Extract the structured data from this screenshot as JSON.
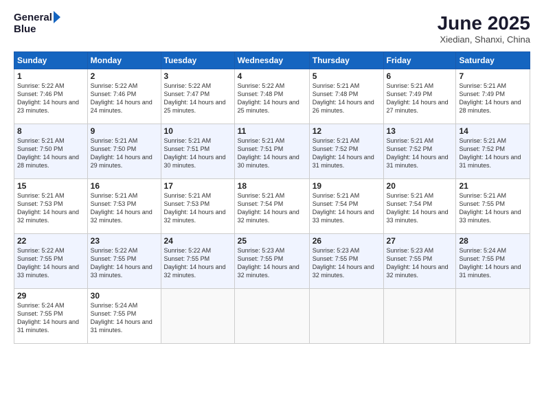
{
  "header": {
    "logo_line1": "General",
    "logo_line2": "Blue",
    "title": "June 2025",
    "subtitle": "Xiedian, Shanxi, China"
  },
  "calendar": {
    "days_of_week": [
      "Sunday",
      "Monday",
      "Tuesday",
      "Wednesday",
      "Thursday",
      "Friday",
      "Saturday"
    ],
    "weeks": [
      [
        null,
        {
          "day": 2,
          "sunrise": "5:22 AM",
          "sunset": "7:46 PM",
          "daylight": "14 hours and 24 minutes."
        },
        {
          "day": 3,
          "sunrise": "5:22 AM",
          "sunset": "7:47 PM",
          "daylight": "14 hours and 25 minutes."
        },
        {
          "day": 4,
          "sunrise": "5:22 AM",
          "sunset": "7:48 PM",
          "daylight": "14 hours and 25 minutes."
        },
        {
          "day": 5,
          "sunrise": "5:21 AM",
          "sunset": "7:48 PM",
          "daylight": "14 hours and 26 minutes."
        },
        {
          "day": 6,
          "sunrise": "5:21 AM",
          "sunset": "7:49 PM",
          "daylight": "14 hours and 27 minutes."
        },
        {
          "day": 7,
          "sunrise": "5:21 AM",
          "sunset": "7:49 PM",
          "daylight": "14 hours and 28 minutes."
        }
      ],
      [
        {
          "day": 1,
          "sunrise": "5:22 AM",
          "sunset": "7:46 PM",
          "daylight": "14 hours and 23 minutes."
        },
        null,
        null,
        null,
        null,
        null,
        null
      ],
      [
        {
          "day": 8,
          "sunrise": "5:21 AM",
          "sunset": "7:50 PM",
          "daylight": "14 hours and 28 minutes."
        },
        {
          "day": 9,
          "sunrise": "5:21 AM",
          "sunset": "7:50 PM",
          "daylight": "14 hours and 29 minutes."
        },
        {
          "day": 10,
          "sunrise": "5:21 AM",
          "sunset": "7:51 PM",
          "daylight": "14 hours and 30 minutes."
        },
        {
          "day": 11,
          "sunrise": "5:21 AM",
          "sunset": "7:51 PM",
          "daylight": "14 hours and 30 minutes."
        },
        {
          "day": 12,
          "sunrise": "5:21 AM",
          "sunset": "7:52 PM",
          "daylight": "14 hours and 31 minutes."
        },
        {
          "day": 13,
          "sunrise": "5:21 AM",
          "sunset": "7:52 PM",
          "daylight": "14 hours and 31 minutes."
        },
        {
          "day": 14,
          "sunrise": "5:21 AM",
          "sunset": "7:52 PM",
          "daylight": "14 hours and 31 minutes."
        }
      ],
      [
        {
          "day": 15,
          "sunrise": "5:21 AM",
          "sunset": "7:53 PM",
          "daylight": "14 hours and 32 minutes."
        },
        {
          "day": 16,
          "sunrise": "5:21 AM",
          "sunset": "7:53 PM",
          "daylight": "14 hours and 32 minutes."
        },
        {
          "day": 17,
          "sunrise": "5:21 AM",
          "sunset": "7:53 PM",
          "daylight": "14 hours and 32 minutes."
        },
        {
          "day": 18,
          "sunrise": "5:21 AM",
          "sunset": "7:54 PM",
          "daylight": "14 hours and 32 minutes."
        },
        {
          "day": 19,
          "sunrise": "5:21 AM",
          "sunset": "7:54 PM",
          "daylight": "14 hours and 33 minutes."
        },
        {
          "day": 20,
          "sunrise": "5:21 AM",
          "sunset": "7:54 PM",
          "daylight": "14 hours and 33 minutes."
        },
        {
          "day": 21,
          "sunrise": "5:21 AM",
          "sunset": "7:55 PM",
          "daylight": "14 hours and 33 minutes."
        }
      ],
      [
        {
          "day": 22,
          "sunrise": "5:22 AM",
          "sunset": "7:55 PM",
          "daylight": "14 hours and 33 minutes."
        },
        {
          "day": 23,
          "sunrise": "5:22 AM",
          "sunset": "7:55 PM",
          "daylight": "14 hours and 33 minutes."
        },
        {
          "day": 24,
          "sunrise": "5:22 AM",
          "sunset": "7:55 PM",
          "daylight": "14 hours and 32 minutes."
        },
        {
          "day": 25,
          "sunrise": "5:23 AM",
          "sunset": "7:55 PM",
          "daylight": "14 hours and 32 minutes."
        },
        {
          "day": 26,
          "sunrise": "5:23 AM",
          "sunset": "7:55 PM",
          "daylight": "14 hours and 32 minutes."
        },
        {
          "day": 27,
          "sunrise": "5:23 AM",
          "sunset": "7:55 PM",
          "daylight": "14 hours and 32 minutes."
        },
        {
          "day": 28,
          "sunrise": "5:24 AM",
          "sunset": "7:55 PM",
          "daylight": "14 hours and 31 minutes."
        }
      ],
      [
        {
          "day": 29,
          "sunrise": "5:24 AM",
          "sunset": "7:55 PM",
          "daylight": "14 hours and 31 minutes."
        },
        {
          "day": 30,
          "sunrise": "5:24 AM",
          "sunset": "7:55 PM",
          "daylight": "14 hours and 31 minutes."
        },
        null,
        null,
        null,
        null,
        null
      ]
    ]
  }
}
